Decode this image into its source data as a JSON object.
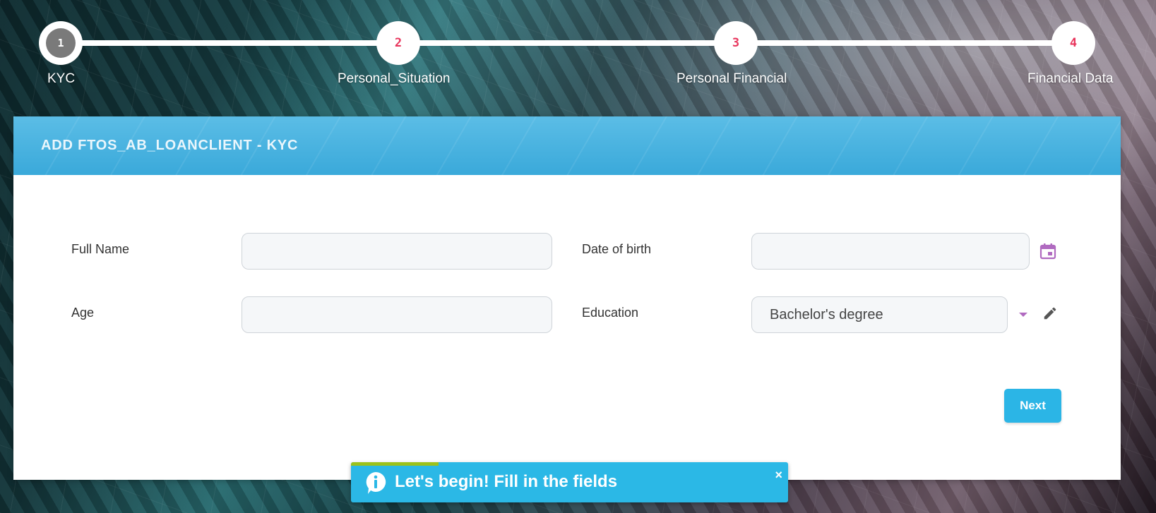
{
  "stepper": {
    "steps": [
      {
        "number": "1",
        "label": "KYC",
        "state": "active"
      },
      {
        "number": "2",
        "label": "Personal_Situation",
        "state": "pending"
      },
      {
        "number": "3",
        "label": "Personal Financial",
        "state": "pending"
      },
      {
        "number": "4",
        "label": "Financial Data",
        "state": "pending"
      }
    ]
  },
  "card": {
    "title": "ADD FTOS_AB_LOANCLIENT - KYC"
  },
  "form": {
    "full_name": {
      "label": "Full Name",
      "value": "",
      "placeholder": ""
    },
    "date_of_birth": {
      "label": "Date of birth",
      "value": "",
      "placeholder": "",
      "icon": "calendar-icon"
    },
    "age": {
      "label": "Age",
      "value": "",
      "placeholder": ""
    },
    "education": {
      "label": "Education",
      "value": "Bachelor's degree",
      "icons": [
        "chevron-down-icon",
        "pencil-icon"
      ]
    }
  },
  "actions": {
    "next_label": "Next"
  },
  "toast": {
    "message": "Let's begin! Fill in the fields",
    "close_glyph": "×",
    "progress": 0.2
  },
  "colors": {
    "accent": "#2bb5e6",
    "step_number": "#e8365d",
    "icon_purple": "#b06ac0",
    "toast_progress": "#9bc11a"
  }
}
